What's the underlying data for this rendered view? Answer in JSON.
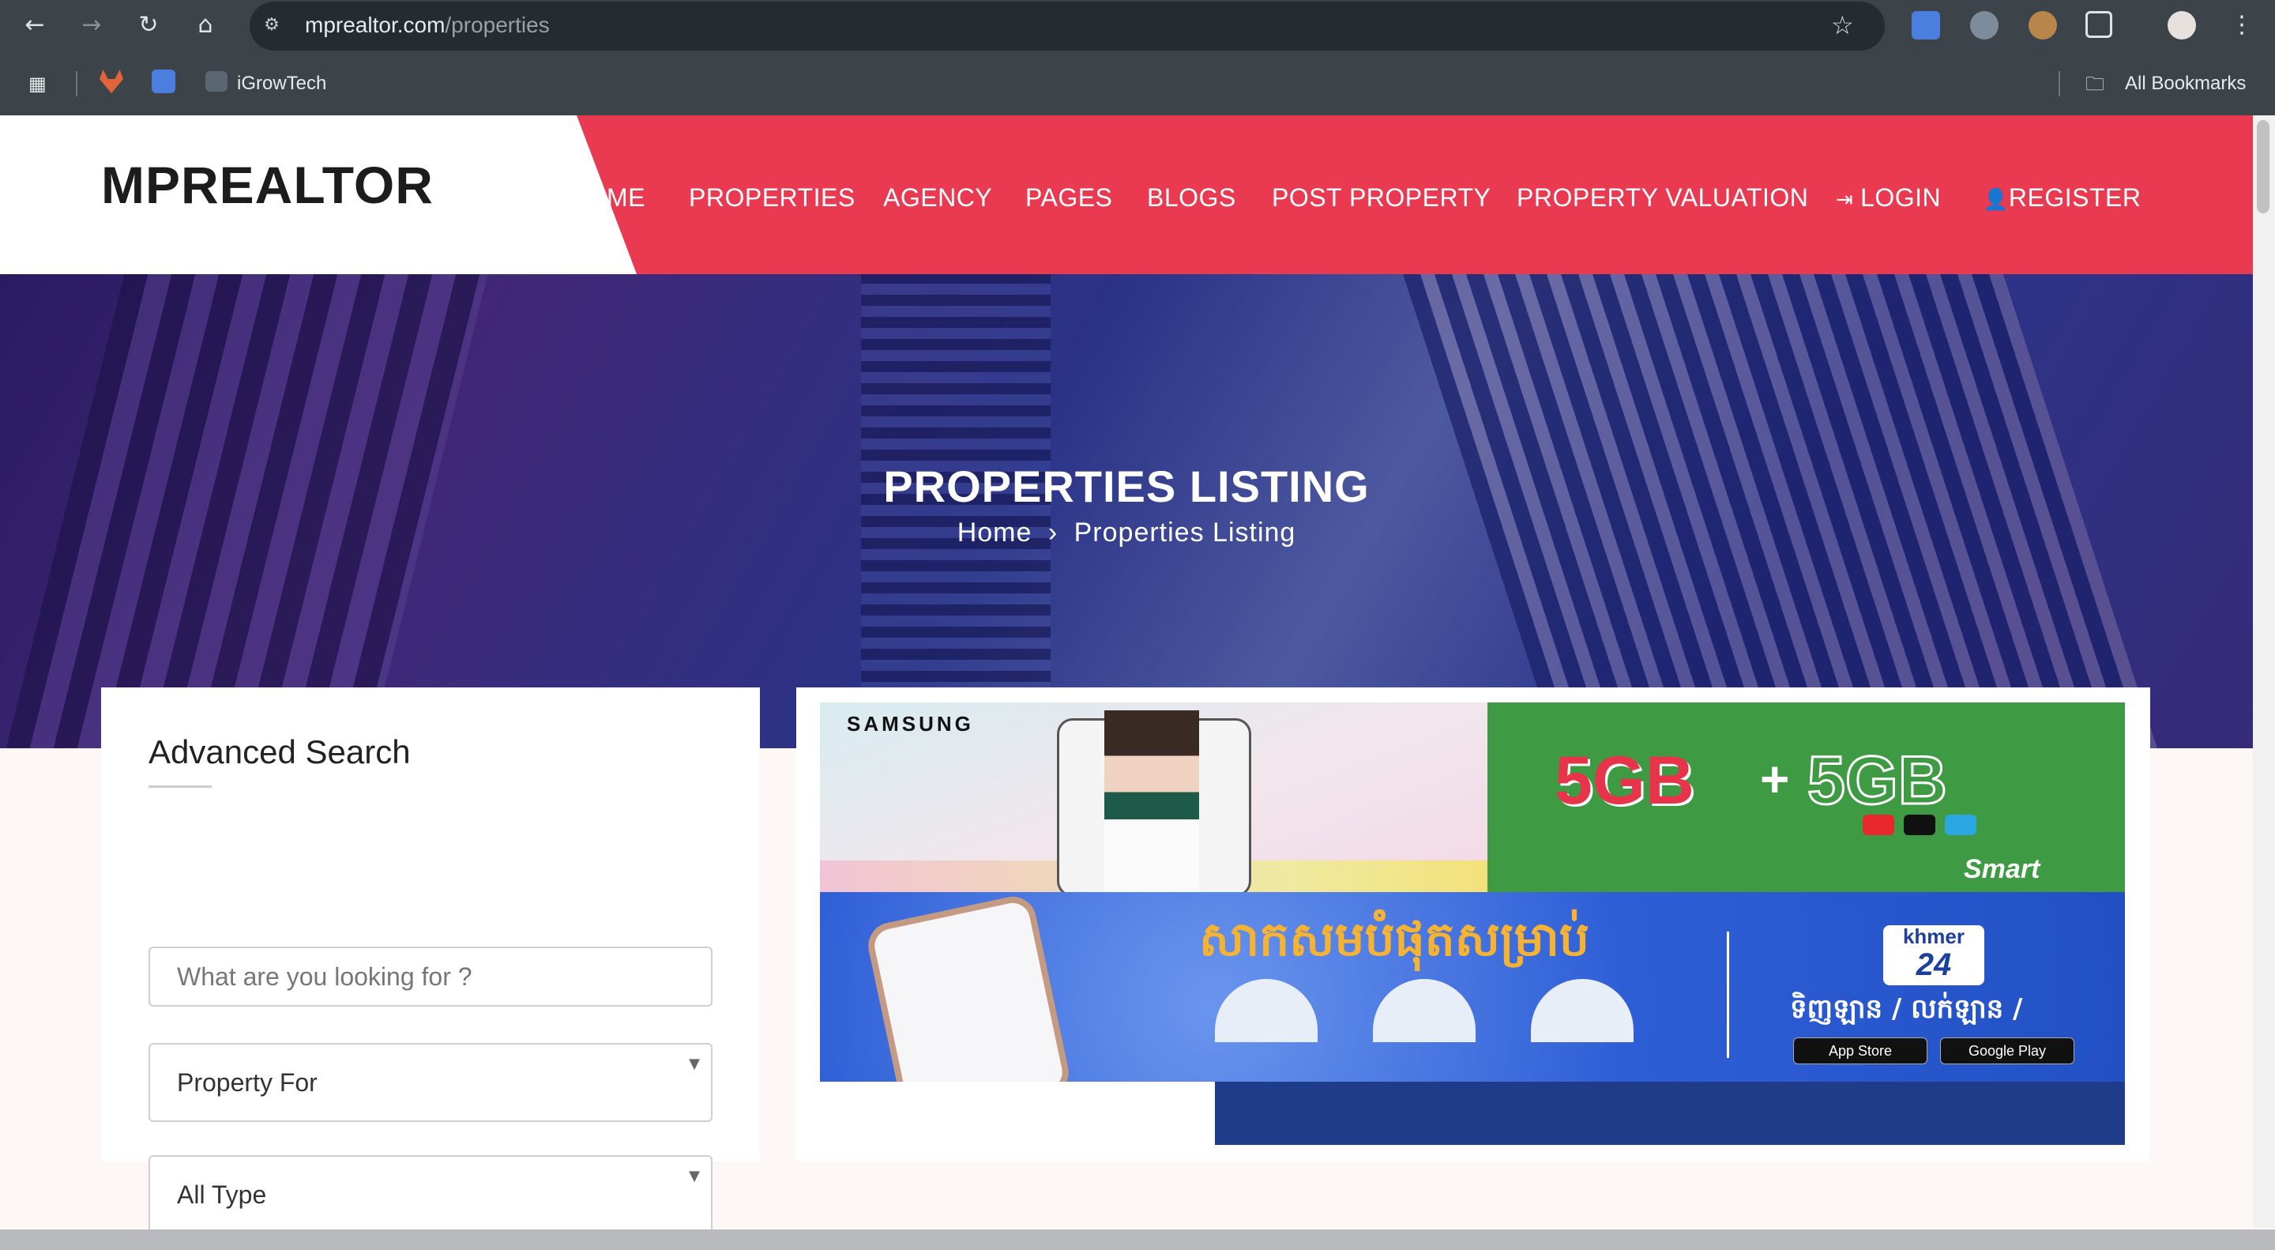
{
  "browser": {
    "url_host": "mprealtor.com",
    "url_path": "/properties",
    "bookmarks": [
      "iGrowTech"
    ],
    "all_bookmarks": "All Bookmarks"
  },
  "site": {
    "logo": "MPREALTOR",
    "nav": [
      "ME",
      "PROPERTIES",
      "AGENCY",
      "PAGES",
      "BLOGS",
      "POST PROPERTY",
      "PROPERTY VALUATION",
      "LOGIN",
      "REGISTER"
    ],
    "accent": "#ea3a51"
  },
  "hero": {
    "title": "PROPERTIES LISTING",
    "crumb_home": "Home",
    "crumb_sep": "›",
    "crumb_current": "Properties Listing"
  },
  "search": {
    "heading": "Advanced Search",
    "query_placeholder": "What are you looking for ?",
    "property_for": "Property For",
    "type": "All Type"
  },
  "ads": {
    "ad1_brand": "SAMSUNG",
    "ad1_offer_a": "5GB",
    "ad1_plus": "+",
    "ad1_offer_b": "5GB",
    "ad1_operator": "Smart",
    "ad2_headline": "សាកសមបំផុតសម្រាប់",
    "ad2_brand_top": "khmer",
    "ad2_brand_num": "24",
    "ad2_tagline": "ទិញឡាន / លក់ឡាន /",
    "ad2_appstore": "App Store",
    "ad2_gplay": "Google Play"
  }
}
